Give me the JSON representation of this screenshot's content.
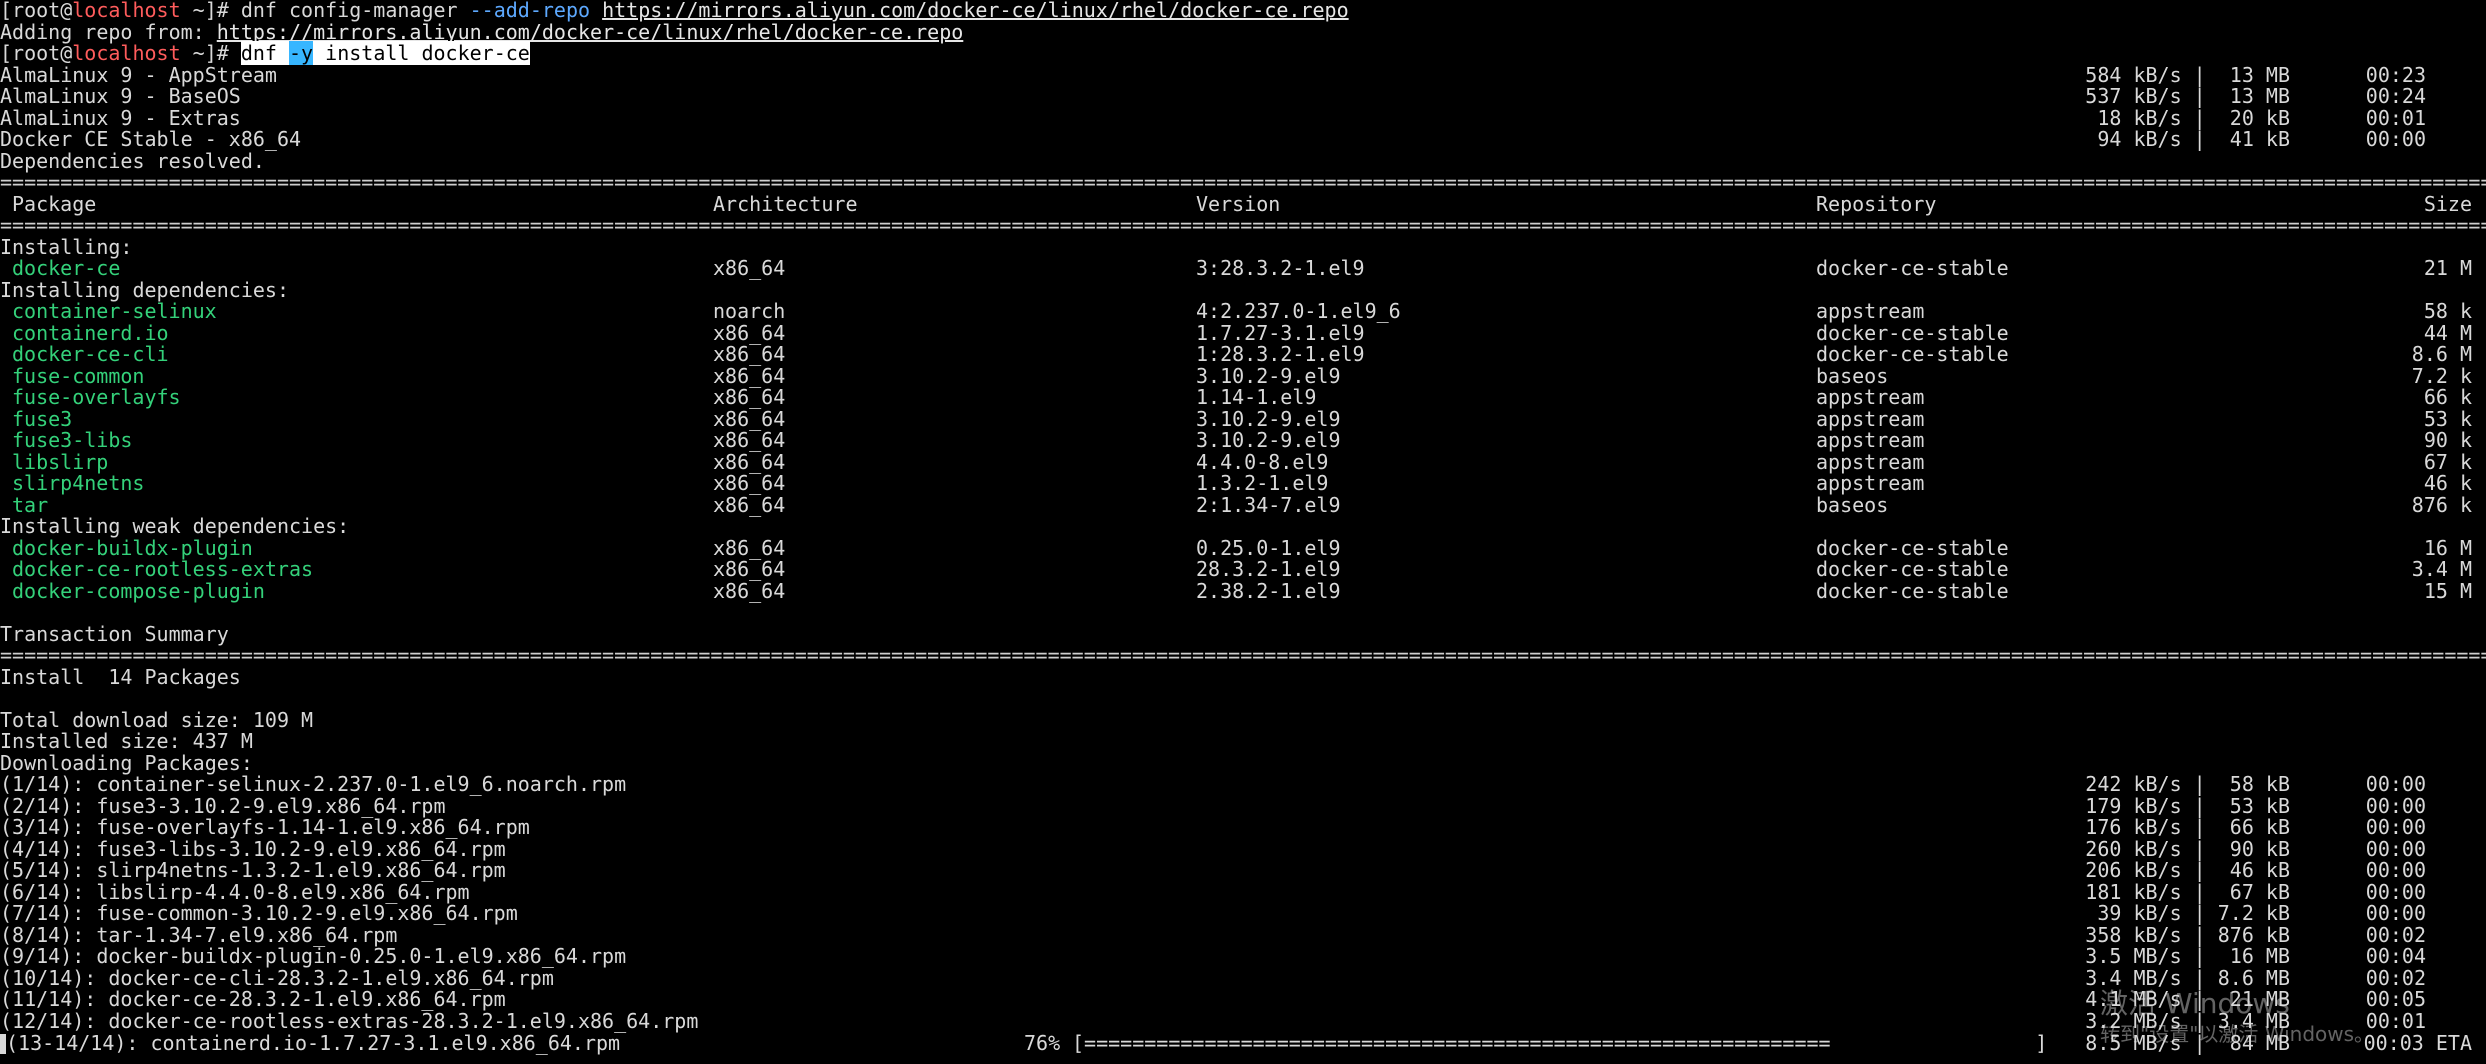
{
  "prompt1": {
    "open": "[root@",
    "host": "localhost",
    "close": " ~]# ",
    "cmd_a": "dnf config-manager ",
    "cmd_opt": "--add-repo",
    "cmd_space": " ",
    "url": "https://mirrors.aliyun.com/docker-ce/linux/rhel/docker-ce.repo"
  },
  "adding": {
    "text": "Adding repo from: ",
    "url": "https://mirrors.aliyun.com/docker-ce/linux/rhel/docker-ce.repo"
  },
  "prompt2": {
    "open": "[root@",
    "host": "localhost",
    "close": " ~]# ",
    "sel_a": "dnf ",
    "sel_opt": "-y",
    "sel_b": " install docker-ce"
  },
  "repos": [
    {
      "name": "AlmaLinux 9 - AppStream",
      "rate": "584 kB/s |  13 MB",
      "time": "00:23"
    },
    {
      "name": "AlmaLinux 9 - BaseOS",
      "rate": "537 kB/s |  13 MB",
      "time": "00:24"
    },
    {
      "name": "AlmaLinux 9 - Extras",
      "rate": "18 kB/s |  20 kB",
      "time": "00:01"
    },
    {
      "name": "Docker CE Stable - x86_64",
      "rate": "94 kB/s |  41 kB",
      "time": "00:00"
    }
  ],
  "deps_resolved": "Dependencies resolved.",
  "eq_line": "==============================================================================================================================================================================================================================",
  "header": {
    "package": "Package",
    "arch": "Architecture",
    "version": "Version",
    "repo": "Repository",
    "size": "Size"
  },
  "installing_label": "Installing:",
  "installing": [
    {
      "name": "docker-ce",
      "arch": "x86_64",
      "version": "3:28.3.2-1.el9",
      "repo": "docker-ce-stable",
      "size": "21 M"
    }
  ],
  "deps_label": "Installing dependencies:",
  "deps": [
    {
      "name": "container-selinux",
      "arch": "noarch",
      "version": "4:2.237.0-1.el9_6",
      "repo": "appstream",
      "size": "58 k"
    },
    {
      "name": "containerd.io",
      "arch": "x86_64",
      "version": "1.7.27-3.1.el9",
      "repo": "docker-ce-stable",
      "size": "44 M"
    },
    {
      "name": "docker-ce-cli",
      "arch": "x86_64",
      "version": "1:28.3.2-1.el9",
      "repo": "docker-ce-stable",
      "size": "8.6 M"
    },
    {
      "name": "fuse-common",
      "arch": "x86_64",
      "version": "3.10.2-9.el9",
      "repo": "baseos",
      "size": "7.2 k"
    },
    {
      "name": "fuse-overlayfs",
      "arch": "x86_64",
      "version": "1.14-1.el9",
      "repo": "appstream",
      "size": "66 k"
    },
    {
      "name": "fuse3",
      "arch": "x86_64",
      "version": "3.10.2-9.el9",
      "repo": "appstream",
      "size": "53 k"
    },
    {
      "name": "fuse3-libs",
      "arch": "x86_64",
      "version": "3.10.2-9.el9",
      "repo": "appstream",
      "size": "90 k"
    },
    {
      "name": "libslirp",
      "arch": "x86_64",
      "version": "4.4.0-8.el9",
      "repo": "appstream",
      "size": "67 k"
    },
    {
      "name": "slirp4netns",
      "arch": "x86_64",
      "version": "1.3.2-1.el9",
      "repo": "appstream",
      "size": "46 k"
    },
    {
      "name": "tar",
      "arch": "x86_64",
      "version": "2:1.34-7.el9",
      "repo": "baseos",
      "size": "876 k"
    }
  ],
  "weak_label": "Installing weak dependencies:",
  "weak": [
    {
      "name": "docker-buildx-plugin",
      "arch": "x86_64",
      "version": "0.25.0-1.el9",
      "repo": "docker-ce-stable",
      "size": "16 M"
    },
    {
      "name": "docker-ce-rootless-extras",
      "arch": "x86_64",
      "version": "28.3.2-1.el9",
      "repo": "docker-ce-stable",
      "size": "3.4 M"
    },
    {
      "name": "docker-compose-plugin",
      "arch": "x86_64",
      "version": "2.38.2-1.el9",
      "repo": "docker-ce-stable",
      "size": "15 M"
    }
  ],
  "summary_label": "Transaction Summary",
  "install_count": "Install  14 Packages",
  "total_download": "Total download size: 109 M",
  "installed_size": "Installed size: 437 M",
  "downloading": "Downloading Packages:",
  "downloads": [
    {
      "file": "(1/14): container-selinux-2.237.0-1.el9_6.noarch.rpm",
      "rate": "242 kB/s |  58 kB",
      "time": "00:00"
    },
    {
      "file": "(2/14): fuse3-3.10.2-9.el9.x86_64.rpm",
      "rate": "179 kB/s |  53 kB",
      "time": "00:00"
    },
    {
      "file": "(3/14): fuse-overlayfs-1.14-1.el9.x86_64.rpm",
      "rate": "176 kB/s |  66 kB",
      "time": "00:00"
    },
    {
      "file": "(4/14): fuse3-libs-3.10.2-9.el9.x86_64.rpm",
      "rate": "260 kB/s |  90 kB",
      "time": "00:00"
    },
    {
      "file": "(5/14): slirp4netns-1.3.2-1.el9.x86_64.rpm",
      "rate": "206 kB/s |  46 kB",
      "time": "00:00"
    },
    {
      "file": "(6/14): libslirp-4.4.0-8.el9.x86_64.rpm",
      "rate": "181 kB/s |  67 kB",
      "time": "00:00"
    },
    {
      "file": "(7/14): fuse-common-3.10.2-9.el9.x86_64.rpm",
      "rate": "39 kB/s | 7.2 kB",
      "time": "00:00"
    },
    {
      "file": "(8/14): tar-1.34-7.el9.x86_64.rpm",
      "rate": "358 kB/s | 876 kB",
      "time": "00:02"
    },
    {
      "file": "(9/14): docker-buildx-plugin-0.25.0-1.el9.x86_64.rpm",
      "rate": "3.5 MB/s |  16 MB",
      "time": "00:04"
    },
    {
      "file": "(10/14): docker-ce-cli-28.3.2-1.el9.x86_64.rpm",
      "rate": "3.4 MB/s | 8.6 MB",
      "time": "00:02"
    },
    {
      "file": "(11/14): docker-ce-28.3.2-1.el9.x86_64.rpm",
      "rate": "4.1 MB/s |  21 MB",
      "time": "00:05"
    },
    {
      "file": "(12/14): docker-ce-rootless-extras-28.3.2-1.el9.x86_64.rpm",
      "rate": "3.2 MB/s | 3.4 MB",
      "time": "00:01"
    }
  ],
  "progress": {
    "file": "(13-14/14): containerd.io-1.7.27-3.1.el9.x86_64.rpm",
    "percent": "76%",
    "bar": "[==============================================================                 ]",
    "rate": "8.5 MB/s |  84 MB",
    "eta": "00:03 ETA"
  },
  "watermark": {
    "line1": "激活 Windows",
    "line2": "转到\"设置\"以激活 Windows。"
  }
}
